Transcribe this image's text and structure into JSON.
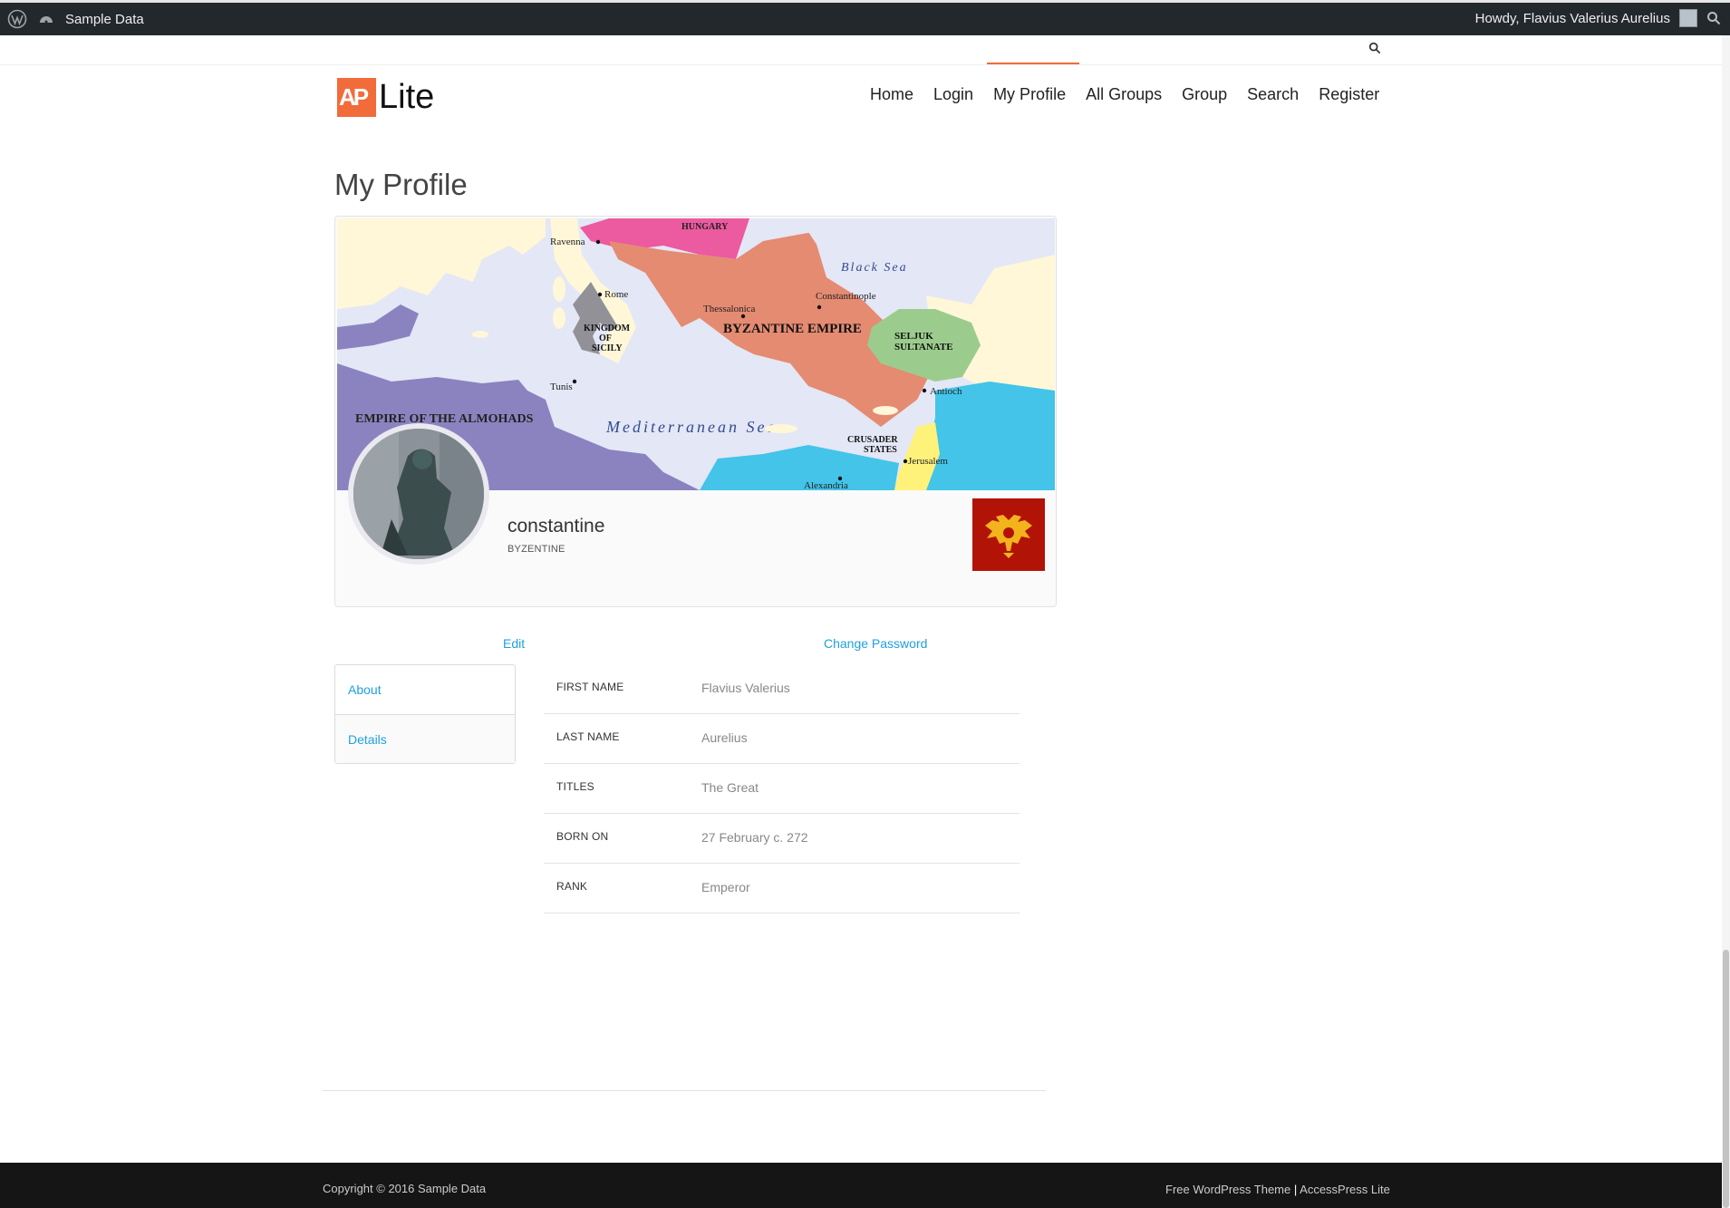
{
  "admin_bar": {
    "site_name": "Sample Data",
    "greeting": "Howdy, Flavius Valerius Aurelius"
  },
  "logo": {
    "mark": "AP",
    "text": "Lite"
  },
  "nav": {
    "items": [
      "Home",
      "Login",
      "My Profile",
      "All Groups",
      "Group",
      "Search",
      "Register"
    ],
    "active": "My Profile"
  },
  "page": {
    "title": "My Profile"
  },
  "cover_map": {
    "labels": {
      "hungary": "HUNGARY",
      "ravenna": "Ravenna",
      "rome": "Rome",
      "black_sea": "Black Sea",
      "constantinople": "Constantinople",
      "thessalonica": "Thessalonica",
      "byzantine": "BYZANTINE EMPIRE",
      "kingdom1": "KINGDOM",
      "kingdom2": "OF",
      "kingdom3": "SICILY",
      "seljuk1": "SELJUK",
      "seljuk2": "SULTANATE",
      "tunis": "Tunis",
      "antioch": "Antioch",
      "almohads": "EMPIRE OF THE ALMOHADS",
      "med_sea": "Mediterranean Sea",
      "crusader1": "CRUSADER",
      "crusader2": "STATES",
      "jerusalem": "Jerusalem",
      "alexandria": "Alexandria"
    }
  },
  "profile": {
    "name": "constantine",
    "group": "BYZENTINE"
  },
  "actions": {
    "edit": "Edit",
    "change_password": "Change Password"
  },
  "tabs": [
    "About",
    "Details"
  ],
  "fields": [
    {
      "label": "FIRST NAME",
      "value": "Flavius Valerius"
    },
    {
      "label": "LAST NAME",
      "value": "Aurelius"
    },
    {
      "label": "TITLES",
      "value": "The Great"
    },
    {
      "label": "BORN ON",
      "value": "27 February c. 272"
    },
    {
      "label": "RANK",
      "value": "Emperor"
    }
  ],
  "footer": {
    "copyright": "Copyright © 2016 Sample Data",
    "theme_link": "Free WordPress Theme",
    "separator": "|",
    "theme_name": "AccessPress Lite"
  },
  "colors": {
    "accent": "#f26b3a",
    "link": "#1fa0e0",
    "admin_bar": "#23282d",
    "footer": "#151515",
    "byzantine": "#e48b72",
    "seljuk": "#9ccc8d",
    "almohads": "#8b83c0",
    "hungary": "#ec5a9f",
    "sea": "#e4e7f6",
    "flag": "#b21307"
  },
  "icons": {
    "admin_logo": "wordpress-icon",
    "site": "dashboard-icon",
    "search": "search-icon"
  }
}
